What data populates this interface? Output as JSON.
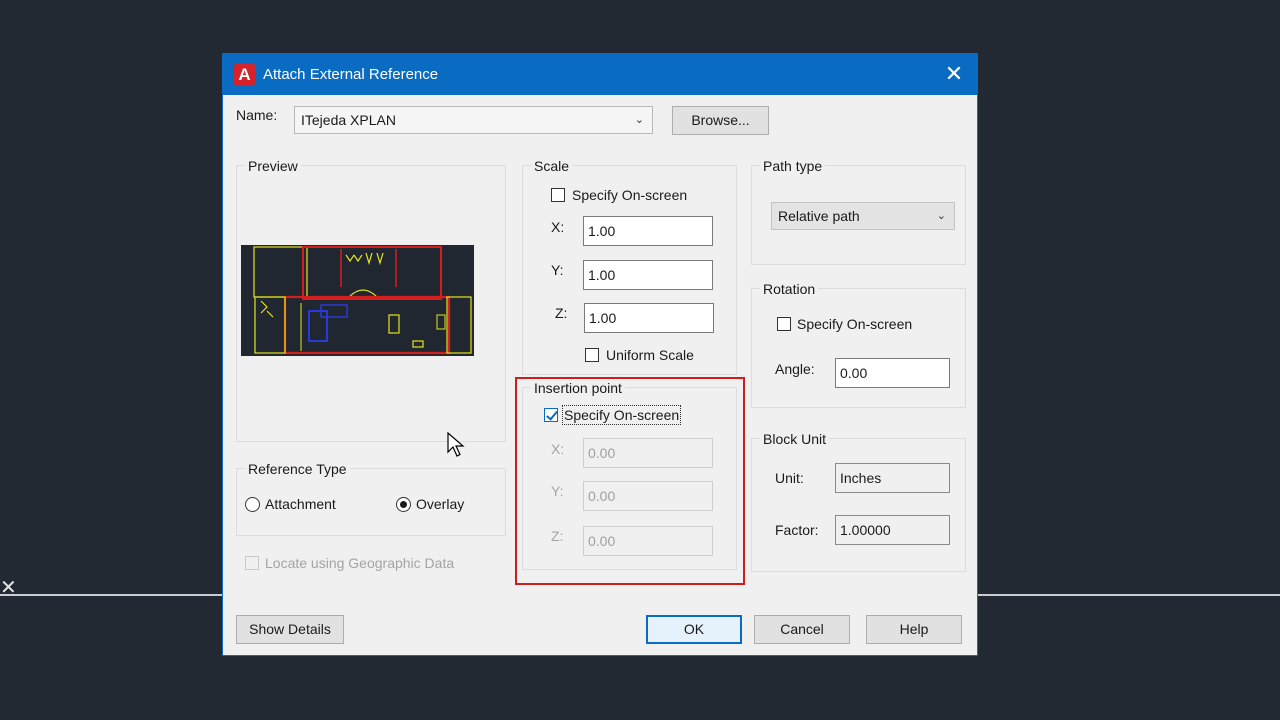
{
  "window": {
    "title": "Attach External Reference",
    "app_icon": "A"
  },
  "name_row": {
    "label": "Name:",
    "value": "ITejeda XPLAN",
    "browse_label": "Browse..."
  },
  "preview": {
    "title": "Preview"
  },
  "reference_type": {
    "title": "Reference Type",
    "attachment_label": "Attachment",
    "overlay_label": "Overlay",
    "selected": "Overlay"
  },
  "geo": {
    "label": "Locate using Geographic Data"
  },
  "scale": {
    "title": "Scale",
    "specify_label": "Specify On-screen",
    "specify_checked": false,
    "x_label": "X:",
    "x_value": "1.00",
    "y_label": "Y:",
    "y_value": "1.00",
    "z_label": "Z:",
    "z_value": "1.00",
    "uniform_label": "Uniform Scale",
    "uniform_checked": false
  },
  "insertion": {
    "title": "Insertion point",
    "specify_label": "Specify On-screen",
    "specify_checked": true,
    "x_label": "X:",
    "x_value": "0.00",
    "y_label": "Y:",
    "y_value": "0.00",
    "z_label": "Z:",
    "z_value": "0.00"
  },
  "path_type": {
    "title": "Path type",
    "value": "Relative path"
  },
  "rotation": {
    "title": "Rotation",
    "specify_label": "Specify On-screen",
    "angle_label": "Angle:",
    "angle_value": "0.00"
  },
  "block_unit": {
    "title": "Block Unit",
    "unit_label": "Unit:",
    "unit_value": "Inches",
    "factor_label": "Factor:",
    "factor_value": "1.00000"
  },
  "buttons": {
    "show_details": "Show Details",
    "ok": "OK",
    "cancel": "Cancel",
    "help": "Help"
  },
  "colors": {
    "titlebar": "#0a6bc2",
    "highlight": "#d11c1c",
    "background": "#222933"
  }
}
